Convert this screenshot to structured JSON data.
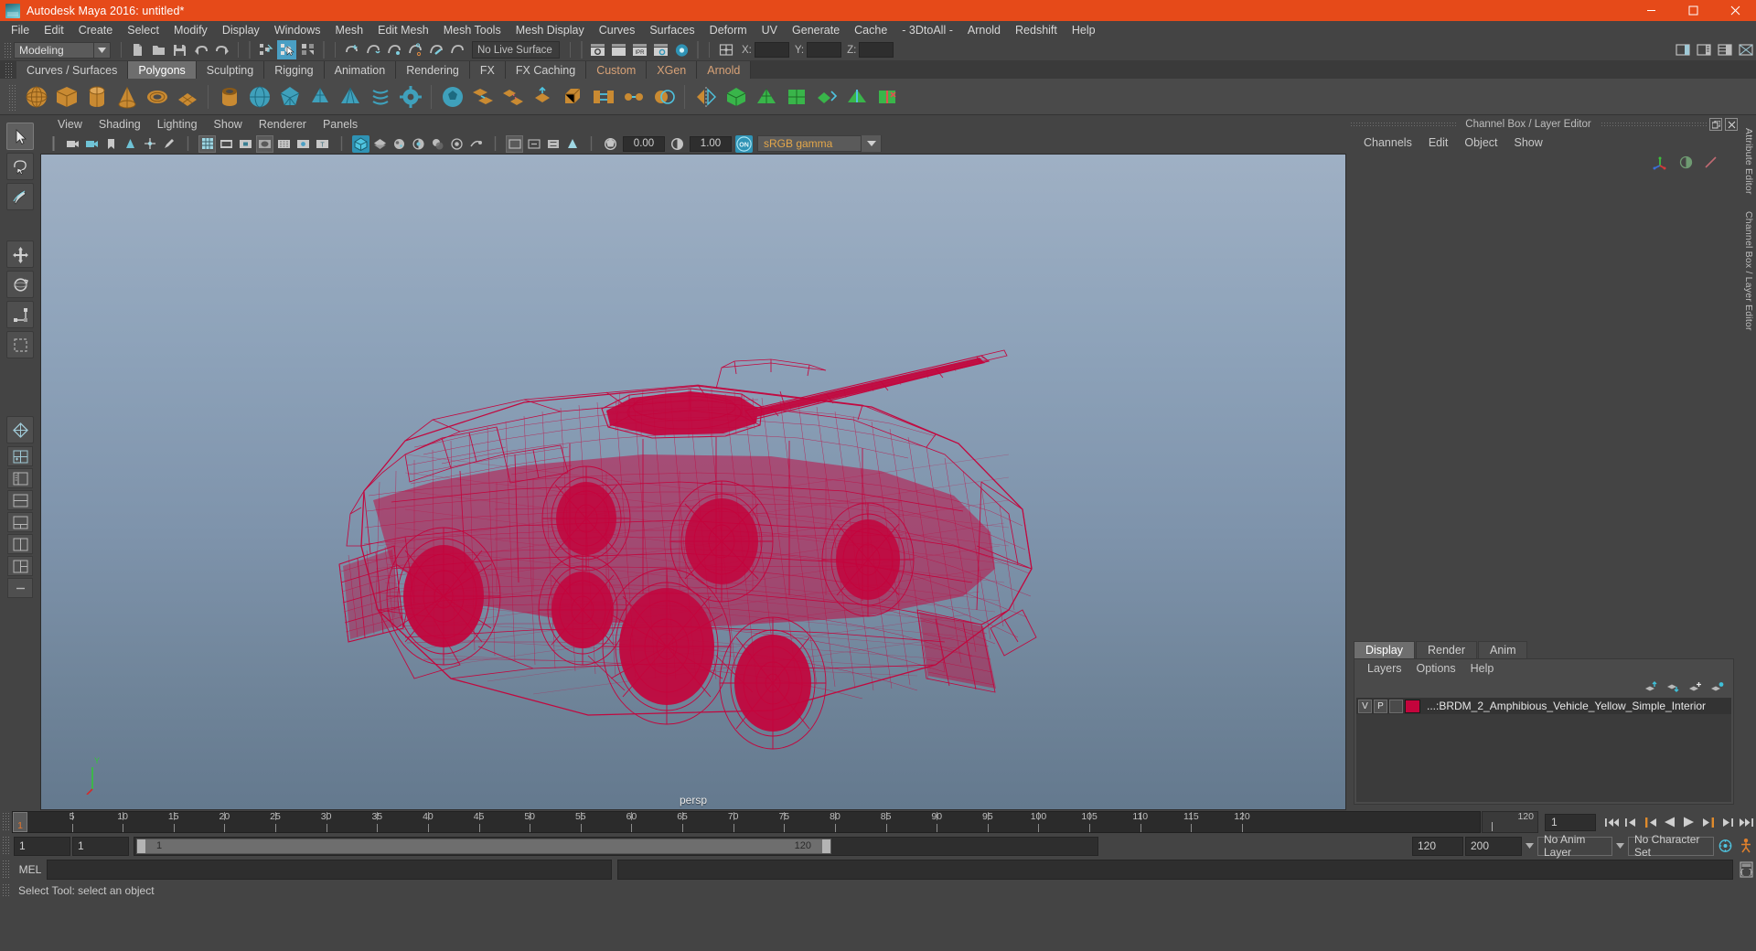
{
  "window": {
    "title": "Autodesk Maya 2016: untitled*",
    "logo_icon": "maya-logo-icon",
    "minimize_icon": "minimize-icon",
    "maximize_icon": "maximize-icon",
    "close_icon": "close-icon",
    "titlebar_color": "#e64a19"
  },
  "menubar": {
    "items": [
      "File",
      "Edit",
      "Create",
      "Select",
      "Modify",
      "Display",
      "Windows",
      "Mesh",
      "Edit Mesh",
      "Mesh Tools",
      "Mesh Display",
      "Curves",
      "Surfaces",
      "Deform",
      "UV",
      "Generate",
      "Cache",
      "- 3DtoAll -",
      "Arnold",
      "Redshift",
      "Help"
    ]
  },
  "statusbar": {
    "mode": "Modeling",
    "mode_arrow_icon": "chevron-down-icon",
    "live_surface": "No Live Surface",
    "coord_labels": [
      "X:",
      "Y:",
      "Z:"
    ],
    "coord_values": [
      "",
      "",
      ""
    ],
    "icons": [
      "new-scene-icon",
      "open-scene-icon",
      "save-scene-icon",
      "undo-icon",
      "redo-icon",
      "select-hierarchy-icon",
      "select-object-icon",
      "select-component-icon",
      "snap-grid-icon",
      "snap-curve-icon",
      "snap-point-icon",
      "snap-projected-icon",
      "snap-view-plane-icon",
      "make-live-icon",
      "render-view-icon",
      "render-current-frame-icon",
      "ipr-render-icon",
      "render-settings-icon",
      "hypershade-icon",
      "editor-layout-icon"
    ],
    "right_icons": [
      "sidebar-attribute-icon",
      "sidebar-tool-icon",
      "sidebar-channel-icon",
      "sidebar-extra-icon"
    ]
  },
  "shelf": {
    "tabs": [
      {
        "label": "Curves / Surfaces",
        "active": false,
        "accent": false
      },
      {
        "label": "Polygons",
        "active": true,
        "accent": false
      },
      {
        "label": "Sculpting",
        "active": false,
        "accent": false
      },
      {
        "label": "Rigging",
        "active": false,
        "accent": false
      },
      {
        "label": "Animation",
        "active": false,
        "accent": false
      },
      {
        "label": "Rendering",
        "active": false,
        "accent": false
      },
      {
        "label": "FX",
        "active": false,
        "accent": false
      },
      {
        "label": "FX Caching",
        "active": false,
        "accent": false
      },
      {
        "label": "Custom",
        "active": false,
        "accent": true
      },
      {
        "label": "XGen",
        "active": false,
        "accent": true
      },
      {
        "label": "Arnold",
        "active": false,
        "accent": true
      }
    ],
    "buttons": [
      "poly-sphere-icon",
      "poly-cube-icon",
      "poly-cylinder-icon",
      "poly-cone-icon",
      "poly-torus-icon",
      "poly-plane-icon",
      "poly-pipe-icon",
      "poly-sphere-smooth-icon",
      "poly-platonic-icon",
      "poly-prism-icon",
      "poly-pyramid-icon",
      "poly-helix-icon",
      "poly-gear-icon",
      "poly-soccer-icon",
      "poly-combine-icon",
      "poly-separate-icon",
      "poly-extrude-icon",
      "poly-bevel-icon",
      "poly-bridge-icon",
      "poly-merge-icon",
      "poly-booleans-icon",
      "poly-mirror-icon",
      "poly-smooth-icon",
      "poly-triangulate-icon",
      "poly-quadrangulate-icon",
      "poly-reduce-icon",
      "poly-crease-icon",
      "poly-delete-edge-icon"
    ]
  },
  "toolbox": {
    "tools": [
      "select-tool-icon",
      "lasso-select-tool-icon",
      "paint-select-tool-icon",
      "move-tool-icon",
      "rotate-tool-icon",
      "scale-tool-icon",
      "last-tool-icon",
      "layout-single-icon",
      "layout-four-view-icon",
      "layout-outliner-persp-icon",
      "layout-hypergraph-icon",
      "layout-persp-graph-icon",
      "layout-two-pane-icon",
      "layout-three-pane-icon",
      "layout-extra-icon"
    ]
  },
  "viewport": {
    "panel_menu": [
      "View",
      "Shading",
      "Lighting",
      "Show",
      "Renderer",
      "Panels"
    ],
    "camera_label": "persp",
    "exposure_value": "0.00",
    "gamma_value": "1.00",
    "color_management": "sRGB gamma",
    "gamma_arrow_icon": "chevron-down-icon",
    "gamma_toggle_label": "ON",
    "toolbar_icons": [
      "select-camera-icon",
      "camera-attributes-icon",
      "bookmark-icon",
      "image-plane-icon",
      "two-d-pan-zoom-icon",
      "grease-pencil-icon",
      "grid-toggle-icon",
      "film-gate-icon",
      "resolution-gate-icon",
      "gate-mask-icon",
      "xray-icon",
      "xray-joints-icon",
      "texture-toggle-icon",
      "smooth-shade-icon",
      "wireframe-shaded-icon",
      "hardware-texturing-icon",
      "lighting-toggle-icon",
      "shadows-icon",
      "ambient-occlusion-icon",
      "motion-blur-icon",
      "isolate-select-icon",
      "hide-selected-icon",
      "show-all-icon",
      "exposure-icon",
      "contrast-icon",
      "color-management-icon"
    ],
    "axis_labels": [
      "Y",
      "X",
      "Z"
    ],
    "model": {
      "name": "BRDM_2_Amphibious_Vehicle",
      "wireframe_color": "#c4043c",
      "background_top": "#9fb0c4",
      "background_bottom": "#64798e"
    }
  },
  "rightdock": {
    "title": "Channel Box / Layer Editor",
    "undock_icon": "undock-icon",
    "close_icon": "close-icon",
    "channel_menu": [
      "Channels",
      "Edit",
      "Object",
      "Show"
    ],
    "channel_icons": [
      "transform-axis-icon",
      "half-circle-icon",
      "slash-icon"
    ],
    "vertical_tabs": [
      "Attribute Editor",
      "Channel Box / Layer Editor"
    ],
    "layer_editor": {
      "tabs": [
        {
          "label": "Display",
          "active": true
        },
        {
          "label": "Render",
          "active": false
        },
        {
          "label": "Anim",
          "active": false
        }
      ],
      "menu": [
        "Layers",
        "Options",
        "Help"
      ],
      "tool_icons": [
        "move-layer-up-icon",
        "move-layer-down-icon",
        "new-layer-icon",
        "new-layer-from-selected-icon"
      ],
      "layers": [
        {
          "visibility": "V",
          "playback": "P",
          "shading": "",
          "color": "#c4043c",
          "name": "...:BRDM_2_Amphibious_Vehicle_Yellow_Simple_Interior"
        }
      ]
    }
  },
  "timeline": {
    "start": 1,
    "end": 120,
    "current_frame": "1",
    "current_frame_label": "1",
    "end_label": "120",
    "ticks": [
      5,
      10,
      15,
      20,
      25,
      30,
      35,
      40,
      45,
      50,
      55,
      60,
      65,
      70,
      75,
      80,
      85,
      90,
      95,
      100,
      105,
      110,
      115,
      120
    ],
    "playback_icons": [
      "go-to-start-icon",
      "step-back-frame-icon",
      "step-back-key-icon",
      "play-backwards-icon",
      "play-forwards-icon",
      "step-forward-key-icon",
      "step-forward-frame-icon",
      "go-to-end-icon"
    ]
  },
  "rangeslider": {
    "anim_start": "1",
    "range_start": "1",
    "slider_start_label": "1",
    "slider_end_label": "120",
    "range_end": "120",
    "anim_end": "200",
    "anim_layer": "No Anim Layer",
    "character_set": "No Character Set",
    "anim_layer_arrow_icon": "chevron-down-icon",
    "character_set_arrow_icon": "chevron-down-icon",
    "auto_key_icon": "auto-keyframe-icon",
    "anim_prefs_icon": "animation-preferences-icon"
  },
  "commandline": {
    "label": "MEL",
    "input_value": "",
    "output_value": "",
    "script_editor_icon": "script-editor-icon"
  },
  "helpline": {
    "text": "Select Tool: select an object"
  }
}
